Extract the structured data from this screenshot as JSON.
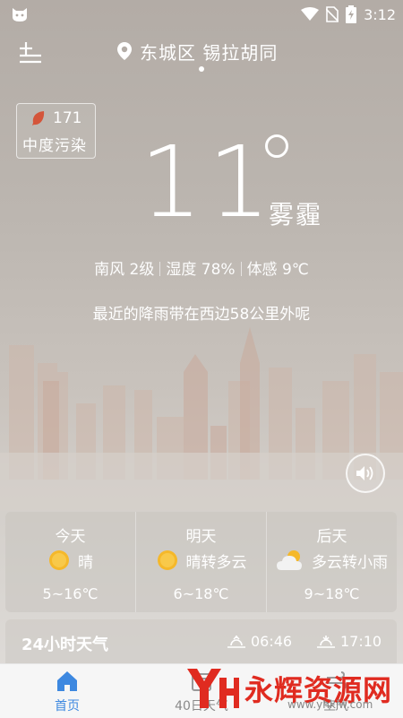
{
  "status_bar": {
    "time": "3:12",
    "battery_icon": "battery-charging-icon",
    "wifi_icon": "wifi-icon",
    "signal_icon": "no-sim-icon",
    "app_icon": "app-cat-icon"
  },
  "header": {
    "location": "东城区 锡拉胡同",
    "menu_icon": "add-city-menu-icon",
    "location_icon": "location-pin-icon"
  },
  "air_quality": {
    "value": "171",
    "level": "中度污染",
    "icon": "leaf-icon",
    "leaf_color": "#d4553a"
  },
  "current": {
    "temperature": "11",
    "condition": "雾霾"
  },
  "details": {
    "wind": "南风 2级",
    "humidity": "湿度 78%",
    "feels_like": "体感 9℃"
  },
  "rain_tip": "最近的降雨带在西边58公里外呢",
  "forecast": [
    {
      "day": "今天",
      "weather": "晴",
      "icon": "sun-icon",
      "range": "5~16℃"
    },
    {
      "day": "明天",
      "weather": "晴转多云",
      "icon": "sun-icon",
      "range": "6~18℃"
    },
    {
      "day": "后天",
      "weather": "多云转小雨",
      "icon": "cloud-sun-icon",
      "range": "9~18℃"
    }
  ],
  "hourly": {
    "title": "24小时天气",
    "sunrise": "06:46",
    "sunset": "17:10"
  },
  "tabs": [
    {
      "label": "首页",
      "icon": "home-icon",
      "active": true
    },
    {
      "label": "40日天气",
      "icon": "calendar-icon",
      "active": false
    },
    {
      "label": "空气",
      "icon": "air-icon",
      "active": false
    }
  ],
  "watermark": {
    "text": "永辉资源网",
    "url": "www.yhkjw.com"
  },
  "colors": {
    "accent": "#3d88e0",
    "sun": "#f5b82a",
    "watermark_red": "#e02b20"
  }
}
